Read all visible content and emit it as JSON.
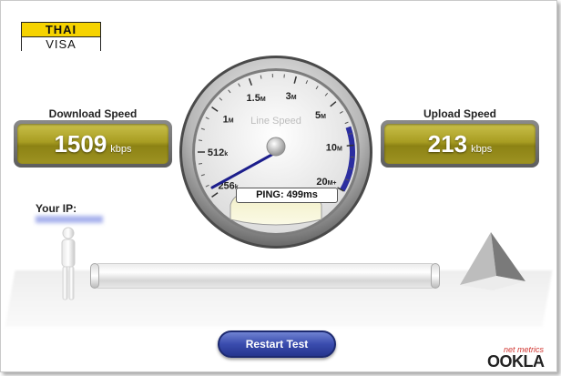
{
  "logo": {
    "line1": "THAI",
    "line2": "VISA"
  },
  "download": {
    "label": "Download Speed",
    "value": "1509",
    "unit": "kbps"
  },
  "upload": {
    "label": "Upload Speed",
    "value": "213",
    "unit": "kbps"
  },
  "ip": {
    "label": "Your IP:"
  },
  "gauge": {
    "title": "Line Speed",
    "ticks": [
      {
        "num": "256",
        "unit": "k"
      },
      {
        "num": "512",
        "unit": "k"
      },
      {
        "num": "1",
        "unit": "M"
      },
      {
        "num": "1.5",
        "unit": "M"
      },
      {
        "num": "3",
        "unit": "M"
      },
      {
        "num": "5",
        "unit": "M"
      },
      {
        "num": "10",
        "unit": "M"
      },
      {
        "num": "20",
        "unit": "M+"
      }
    ],
    "ping": "PING: 499ms",
    "colors": {
      "arc": "#2c2ea0",
      "needle": "#1c1e8c"
    }
  },
  "button": {
    "restart": "Restart Test"
  },
  "brand": {
    "small": "net metrics",
    "main": "OOKLA"
  },
  "colors": {
    "panel": "#a89d22",
    "button": "#3a4cae",
    "logo_yellow": "#f6d300"
  }
}
